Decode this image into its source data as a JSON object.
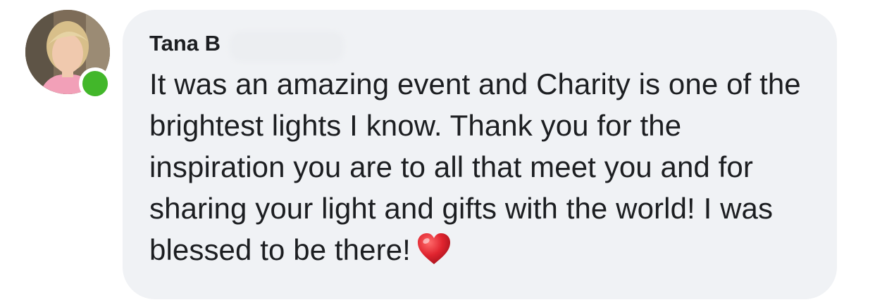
{
  "comment": {
    "author_name": "Tana B",
    "text": "It was an amazing event and Charity is one of the brightest lights I know. Thank you for the inspiration you are to all that meet you and for sharing your light and gifts with the world! I was blessed to be there!",
    "emoji_icon": "red-heart-icon",
    "presence_status": "online"
  },
  "colors": {
    "bubble_background": "#f0f2f5",
    "text": "#1c1e21",
    "presence_online": "#42b72a",
    "heart": "#e0242f"
  }
}
